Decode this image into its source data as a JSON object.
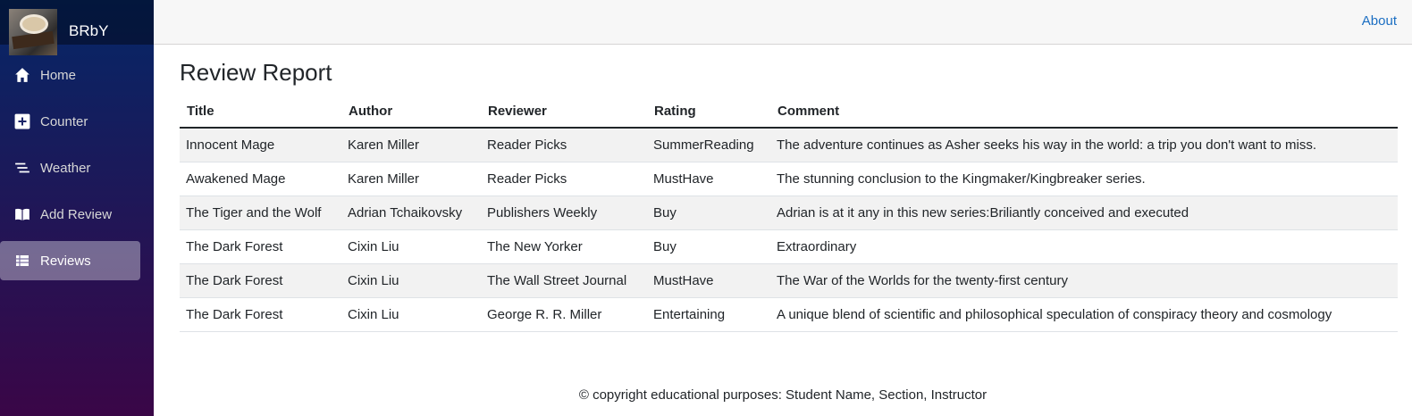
{
  "brand": {
    "name": "BRbY",
    "logo_icon": "coffee-book-photo"
  },
  "nav": {
    "items": [
      {
        "label": "Home",
        "icon": "home-icon",
        "active": false
      },
      {
        "label": "Counter",
        "icon": "plus-icon",
        "active": false
      },
      {
        "label": "Weather",
        "icon": "list-icon",
        "active": false
      },
      {
        "label": "Add Review",
        "icon": "book-icon",
        "active": false
      },
      {
        "label": "Reviews",
        "icon": "table-icon",
        "active": true
      }
    ]
  },
  "header": {
    "about_label": "About"
  },
  "page": {
    "title": "Review Report"
  },
  "table": {
    "columns": [
      "Title",
      "Author",
      "Reviewer",
      "Rating",
      "Comment"
    ],
    "rows": [
      [
        "Innocent Mage",
        "Karen Miller",
        "Reader Picks",
        "SummerReading",
        "The adventure continues as Asher seeks his way in the world: a trip you don't want to miss."
      ],
      [
        "Awakened Mage",
        "Karen Miller",
        "Reader Picks",
        "MustHave",
        "The stunning conclusion to the Kingmaker/Kingbreaker series."
      ],
      [
        "The Tiger and the Wolf",
        "Adrian Tchaikovsky",
        "Publishers Weekly",
        "Buy",
        "Adrian is at it any in this new series:Briliantly conceived and executed"
      ],
      [
        "The Dark Forest",
        "Cixin Liu",
        "The New Yorker",
        "Buy",
        "Extraordinary"
      ],
      [
        "The Dark Forest",
        "Cixin Liu",
        "The Wall Street Journal",
        "MustHave",
        "The War of the Worlds for the twenty-first century"
      ],
      [
        "The Dark Forest",
        "Cixin Liu",
        "George R. R. Miller",
        "Entertaining",
        "A unique blend of scientific and philosophical speculation of conspiracy theory and cosmology"
      ]
    ]
  },
  "footer": {
    "text": "© copyright educational purposes: Student Name, Section, Instructor"
  },
  "colors": {
    "sidebar_top": "#052767",
    "sidebar_bottom": "#3a0647",
    "link": "#1b6ec2",
    "active_nav_bg": "rgba(255,255,255,0.37)"
  }
}
